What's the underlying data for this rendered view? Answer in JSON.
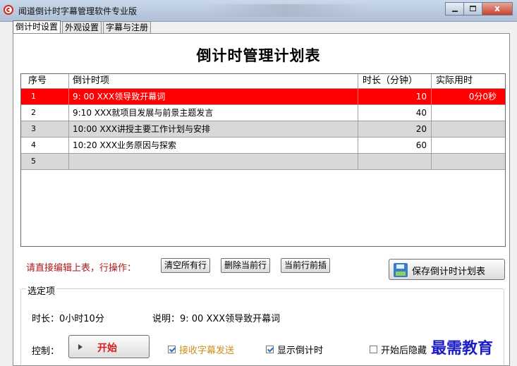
{
  "window": {
    "title": "闻道倒计时字幕管理软件专业版"
  },
  "tabs": [
    {
      "label": "倒计时设置",
      "active": true
    },
    {
      "label": "外观设置",
      "active": false
    },
    {
      "label": "字幕与注册",
      "active": false
    }
  ],
  "page": {
    "title": "倒计时管理计划表"
  },
  "table": {
    "headers": [
      "序号",
      "倒计时项",
      "时长（分钟）",
      "实际用时"
    ],
    "rows": [
      {
        "no": "1",
        "item": "9: 00 XXX领导致开幕词",
        "duration": "10",
        "actual": "0分0秒",
        "state": "selected"
      },
      {
        "no": "2",
        "item": "9:10  XXX就项目发展与前景主题发言",
        "duration": "40",
        "actual": "",
        "state": "white"
      },
      {
        "no": "3",
        "item": "10:00 XXX讲授主要工作计划与安排",
        "duration": "20",
        "actual": "",
        "state": "grey"
      },
      {
        "no": "4",
        "item": "10:20 XXX业务原因与探索",
        "duration": "60",
        "actual": "",
        "state": "white"
      },
      {
        "no": "5",
        "item": "",
        "duration": "",
        "actual": "",
        "state": "grey"
      }
    ]
  },
  "ops": {
    "label": "请直接编辑上表，行操作：",
    "clear_all": "清空所有行",
    "delete_row": "删除当前行",
    "insert_before": "当前行前插",
    "save": "保存倒计时计划表"
  },
  "options": {
    "group_title": "选定项",
    "duration": "时长：0小时10分",
    "description": "说明：9: 00 XXX领导致开幕词",
    "control_label": "控制：",
    "start": "开始",
    "receive_subtitle": "接收字幕发送",
    "show_countdown": "显示倒计时",
    "hide_after_start": "开始后隐藏"
  },
  "watermark": "最需教育",
  "colors": {
    "selected_row": "#ff0000",
    "alt_row": "#d8d8d8",
    "accent_text": "#b0191d"
  }
}
